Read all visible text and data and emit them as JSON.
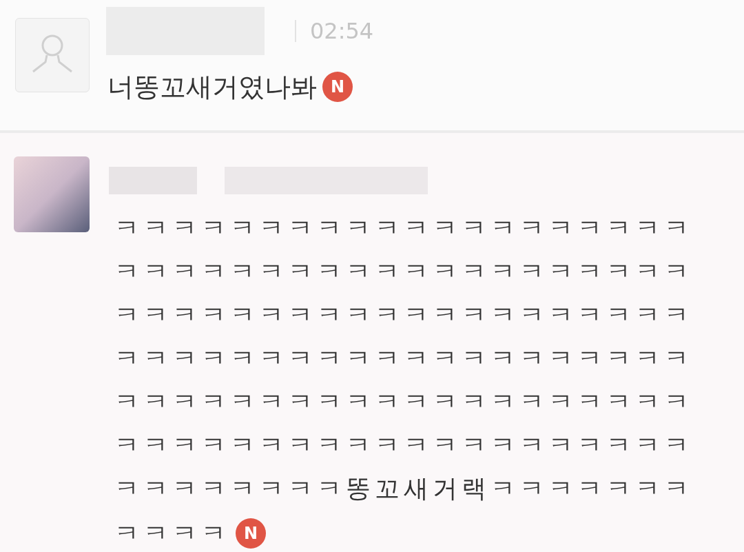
{
  "comments": [
    {
      "avatar": {
        "kind": "default"
      },
      "time": "02:54",
      "lines": [
        "너똥꼬새거였나봐"
      ],
      "new_badge": "N"
    },
    {
      "avatar": {
        "kind": "picture"
      },
      "lines": [
        "ㅋㅋㅋㅋㅋㅋㅋㅋㅋㅋㅋㅋㅋㅋㅋㅋㅋㅋㅋㅋ",
        "ㅋㅋㅋㅋㅋㅋㅋㅋㅋㅋㅋㅋㅋㅋㅋㅋㅋㅋㅋㅋ",
        "ㅋㅋㅋㅋㅋㅋㅋㅋㅋㅋㅋㅋㅋㅋㅋㅋㅋㅋㅋㅋ",
        "ㅋㅋㅋㅋㅋㅋㅋㅋㅋㅋㅋㅋㅋㅋㅋㅋㅋㅋㅋㅋ",
        "ㅋㅋㅋㅋㅋㅋㅋㅋㅋㅋㅋㅋㅋㅋㅋㅋㅋㅋㅋㅋ",
        "ㅋㅋㅋㅋㅋㅋㅋㅋㅋㅋㅋㅋㅋㅋㅋㅋㅋㅋㅋㅋ",
        "ㅋㅋㅋㅋㅋㅋㅋㅋ똥꼬새거랙ㅋㅋㅋㅋㅋㅋㅋ",
        "ㅋㅋㅋㅋ"
      ],
      "new_badge": "N"
    }
  ]
}
